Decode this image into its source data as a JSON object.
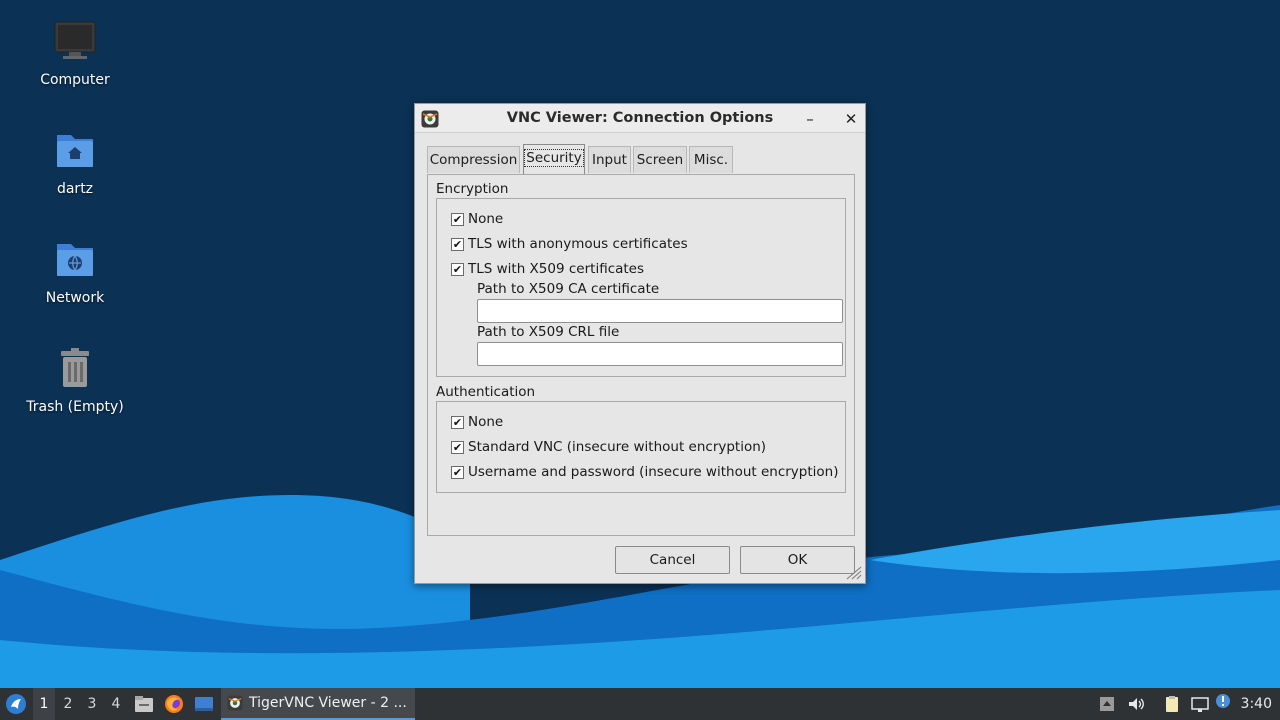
{
  "desktop": {
    "icons": [
      {
        "label": "Computer",
        "icon": "computer-icon"
      },
      {
        "label": "dartz",
        "icon": "home-folder-icon"
      },
      {
        "label": "Network",
        "icon": "network-folder-icon"
      },
      {
        "label": "Trash (Empty)",
        "icon": "trash-icon"
      }
    ]
  },
  "dialog": {
    "title": "VNC Viewer: Connection Options",
    "minimize_glyph": "–",
    "close_glyph": "✕",
    "tabs": [
      {
        "label": "Compression",
        "active": false
      },
      {
        "label": "Security",
        "active": true
      },
      {
        "label": "Input",
        "active": false
      },
      {
        "label": "Screen",
        "active": false
      },
      {
        "label": "Misc.",
        "active": false
      }
    ],
    "encryption": {
      "title": "Encryption",
      "options": [
        {
          "label": "None",
          "checked": true
        },
        {
          "label": "TLS with anonymous certificates",
          "checked": true
        },
        {
          "label": "TLS with X509 certificates",
          "checked": true
        }
      ],
      "ca_label": "Path to X509 CA certificate",
      "ca_value": "",
      "crl_label": "Path to X509 CRL file",
      "crl_value": ""
    },
    "authentication": {
      "title": "Authentication",
      "options": [
        {
          "label": "None",
          "checked": true
        },
        {
          "label": "Standard VNC (insecure without encryption)",
          "checked": true
        },
        {
          "label": "Username and password (insecure without encryption)",
          "checked": true
        }
      ]
    },
    "buttons": {
      "cancel": "Cancel",
      "ok": "OK"
    },
    "check_glyph": "✔"
  },
  "taskbar": {
    "workspaces": [
      "1",
      "2",
      "3",
      "4"
    ],
    "active_workspace": "1",
    "task_label": "TigerVNC Viewer - 2 ...",
    "clock": "3:40"
  },
  "colors": {
    "desktop_bg": "#0b3155",
    "wave_light": "#1e9be6",
    "wave_mid": "#0e7fd0",
    "taskbar": "#2f3235"
  }
}
